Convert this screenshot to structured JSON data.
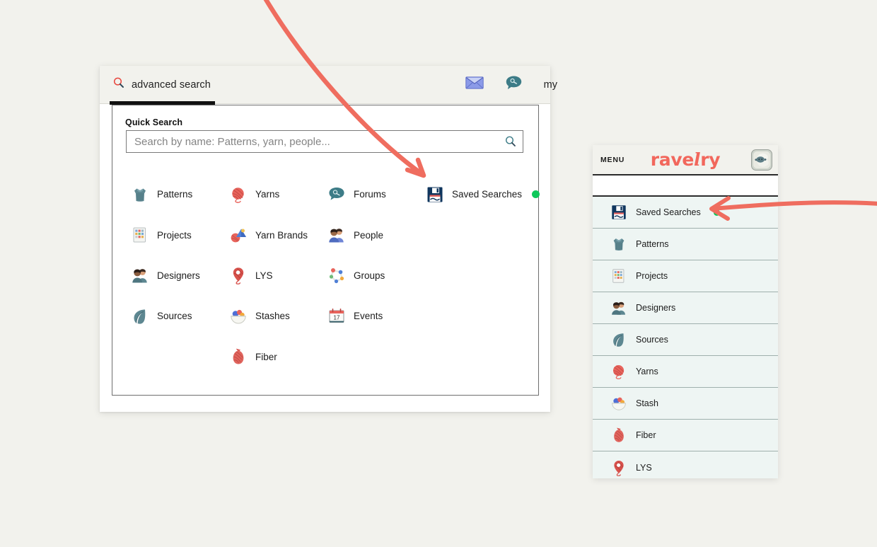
{
  "page": {
    "background_color": "#f2f2ed",
    "annotation_color": "#ef6d5f"
  },
  "window": {
    "topbar": {
      "advanced_search_label": "advanced search",
      "search_icon": "magnifier-icon",
      "mail_icon": "envelope-icon",
      "forums_icon": "forum-bubble-icon",
      "my_label": "my"
    },
    "quick_search": {
      "heading": "Quick Search",
      "input_value": "",
      "input_placeholder": "Search by name: Patterns, yarn, people...",
      "input_icon": "magnifier-icon"
    },
    "grid": [
      {
        "label": "Patterns",
        "icon": "sweater-icon",
        "badge": false
      },
      {
        "label": "Yarns",
        "icon": "yarn-ball-icon",
        "badge": false
      },
      {
        "label": "Forums",
        "icon": "forum-bubble-icon",
        "badge": false
      },
      {
        "label": "Saved Searches",
        "icon": "floppy-disk-icon",
        "badge": true
      },
      {
        "label": "Projects",
        "icon": "projects-grid-icon",
        "badge": false
      },
      {
        "label": "Yarn Brands",
        "icon": "yarn-brands-icon",
        "badge": false
      },
      {
        "label": "People",
        "icon": "people-icon",
        "badge": false
      },
      {
        "label": "",
        "icon": "",
        "badge": false
      },
      {
        "label": "Designers",
        "icon": "designers-icon",
        "badge": false
      },
      {
        "label": "LYS",
        "icon": "map-pin-icon",
        "badge": false
      },
      {
        "label": "Groups",
        "icon": "groups-node-icon",
        "badge": false
      },
      {
        "label": "",
        "icon": "",
        "badge": false
      },
      {
        "label": "Sources",
        "icon": "leaf-icon",
        "badge": false
      },
      {
        "label": "Stashes",
        "icon": "stash-bowl-icon",
        "badge": false
      },
      {
        "label": "Events",
        "icon": "calendar-icon",
        "badge": false
      },
      {
        "label": "",
        "icon": "",
        "badge": false
      },
      {
        "label": "",
        "icon": "",
        "badge": false
      },
      {
        "label": "Fiber",
        "icon": "fiber-bag-icon",
        "badge": false
      },
      {
        "label": "",
        "icon": "",
        "badge": false
      },
      {
        "label": "",
        "icon": "",
        "badge": false
      }
    ],
    "badge_color": "#0ec85a"
  },
  "mobile_menu": {
    "header": {
      "menu_label": "MENU",
      "logo_text": "ravelry",
      "logo_color": "#f2675c",
      "avatar_icon": "sheep-avatar-icon"
    },
    "items": [
      {
        "label": "Saved Searches",
        "icon": "floppy-disk-icon",
        "badge": true
      },
      {
        "label": "Patterns",
        "icon": "sweater-icon",
        "badge": false
      },
      {
        "label": "Projects",
        "icon": "projects-grid-icon",
        "badge": false
      },
      {
        "label": "Designers",
        "icon": "designers-icon",
        "badge": false
      },
      {
        "label": "Sources",
        "icon": "leaf-icon",
        "badge": false
      },
      {
        "label": "Yarns",
        "icon": "yarn-ball-icon",
        "badge": false
      },
      {
        "label": "Stash",
        "icon": "stash-bowl-icon",
        "badge": false
      },
      {
        "label": "Fiber",
        "icon": "fiber-bag-icon",
        "badge": false
      },
      {
        "label": "LYS",
        "icon": "map-pin-icon",
        "badge": false
      }
    ],
    "badge_color": "#0ec85a"
  },
  "annotations": [
    {
      "name": "arrow-to-saved-searches-desktop",
      "shape": "diagonal-arrow-down-right"
    },
    {
      "name": "arrow-to-saved-searches-mobile",
      "shape": "curved-arrow-left"
    }
  ]
}
